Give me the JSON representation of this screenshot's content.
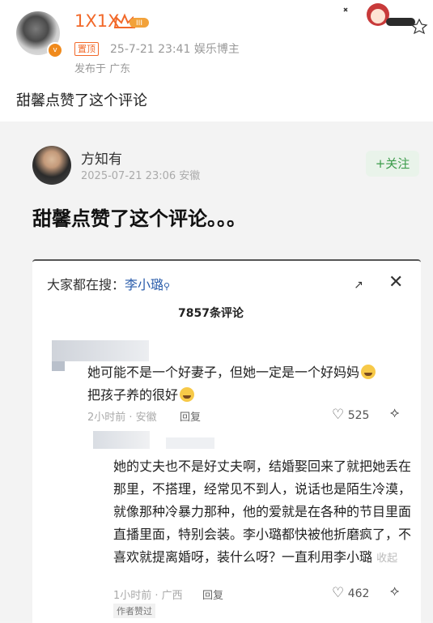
{
  "post": {
    "username": "1X1X",
    "level_badge": "III",
    "ribbon": "置顶",
    "timestamp": "25-7-21 23:41",
    "role": "娱乐博主",
    "location": "发布于 广东",
    "text": "甜馨点赞了这个评论"
  },
  "card": {
    "name": "方知有",
    "meta": "2025-07-21 23:06 安徽",
    "follow_label": "+关注",
    "text": "甜馨点赞了这个评论。。。"
  },
  "comments_panel": {
    "search_prefix": "大家都在搜：",
    "search_keyword": "李小璐",
    "expand_icon": "↗",
    "close_icon": "✕",
    "count": "7857条评论",
    "comments": [
      {
        "line1": "她可能不是一个好妻子，但她一定是一个好妈妈",
        "line2": "把孩子养的很好",
        "meta": "2小时前 · 安徽",
        "reply": "回复",
        "likes": "525"
      },
      {
        "text": "她的丈夫也不是好丈夫啊，结婚娶回来了就把她丢在那里，不搭理，经常见不到人，说话也是陌生冷漠，就像那种冷暴力那种，他的爱就是在各种的节目里面直播里面，特别会装。李小璐都快被他折磨疯了，不喜欢就提离婚呀，装什么呀？一直利用李小璐",
        "fold": "收起",
        "meta": "1小时前 · 广西",
        "reply": "回复",
        "likes": "462",
        "author_badge": "作者赞过"
      }
    ]
  }
}
